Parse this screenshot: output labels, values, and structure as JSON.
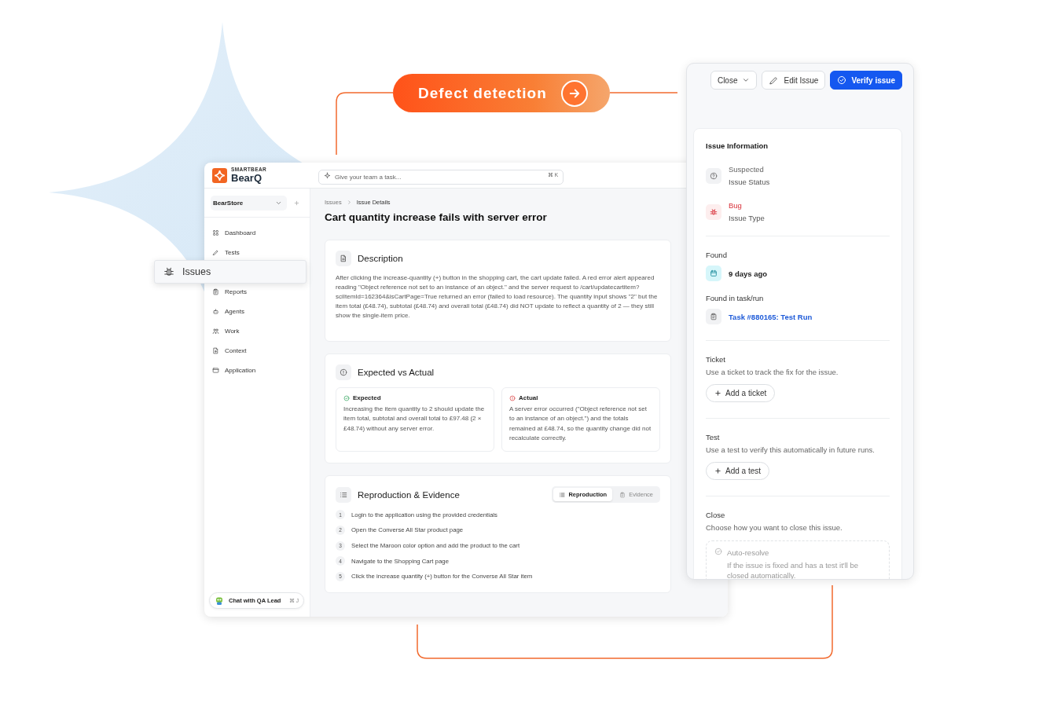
{
  "banner": {
    "label": "Defect detection"
  },
  "app": {
    "logo": {
      "brand": "SMARTBEAR",
      "product": "BearQ"
    },
    "search": {
      "placeholder": "Give your team a task...",
      "shortcut": "⌘ K"
    },
    "workspace": {
      "value": "BearStore"
    },
    "nav": [
      {
        "label": "Dashboard",
        "selected": false
      },
      {
        "label": "Tests",
        "selected": false
      },
      {
        "label": "Issues",
        "selected": true
      },
      {
        "label": "Reports",
        "selected": false
      },
      {
        "label": "Agents",
        "selected": false
      },
      {
        "label": "Work",
        "selected": false
      },
      {
        "label": "Context",
        "selected": false
      },
      {
        "label": "Application",
        "selected": false
      }
    ],
    "chat": {
      "label": "Chat with QA Lead",
      "shortcut": "⌘ J"
    },
    "breadcrumb": [
      "Issues",
      "Issue Details"
    ],
    "title": "Cart quantity increase fails with server error",
    "description": {
      "heading": "Description",
      "text": "After clicking the increase-quantity (+) button in the shopping cart, the cart update failed. A red error alert appeared reading \"Object reference not set to an instance of an object.\" and the server request to /cart/updatecartitem?sciItemId=162364&isCartPage=True returned an error (failed to load resource). The quantity input shows \"2\" but the item total (£48.74), subtotal (£48.74) and overall total (£48.74) did NOT update to reflect a quantity of 2 — they still show the single-item price."
    },
    "comparison": {
      "heading": "Expected vs Actual",
      "expected": {
        "label": "Expected",
        "text": "Increasing the item quantity to 2 should update the item total, subtotal and overall total to £97.48 (2 × £48.74) without any server error."
      },
      "actual": {
        "label": "Actual",
        "text": "A server error occurred (\"Object reference not set to an instance of an object.\") and the totals remained at £48.74, so the quantity change did not recalculate correctly."
      }
    },
    "reproduction": {
      "heading": "Reproduction & Evidence",
      "tabs": [
        {
          "label": "Reproduction",
          "selected": true
        },
        {
          "label": "Evidence",
          "selected": false
        }
      ],
      "steps": [
        {
          "number": "1",
          "text": "Login to the application using the provided credentials"
        },
        {
          "number": "2",
          "text": "Open the Converse All Star product page"
        },
        {
          "number": "3",
          "text": "Select the Maroon color option and add the product to the cart"
        },
        {
          "number": "4",
          "text": "Navigate to the Shopping Cart page"
        },
        {
          "number": "5",
          "text": "Click the increase quantity (+) button for the Converse All Star item"
        }
      ]
    }
  },
  "panel": {
    "actions": [
      {
        "label": "Close",
        "kind": "menu"
      },
      {
        "label": "Edit Issue",
        "kind": "edit"
      },
      {
        "label": "Verify issue",
        "kind": "primary"
      }
    ],
    "info": {
      "heading": "Issue Information",
      "fields": [
        {
          "value": "Suspected",
          "label": "Issue Status",
          "kind": "status"
        },
        {
          "value": "Bug",
          "label": "Issue Type",
          "kind": "bug"
        }
      ]
    },
    "found": {
      "label": "Found",
      "value": "9 days ago"
    },
    "task": {
      "label": "Found in task/run",
      "value": "Task #880165: Test Run"
    },
    "sections": [
      {
        "title": "Ticket",
        "text": "Use a ticket to track the fix for the issue.",
        "button": "Add a ticket"
      },
      {
        "title": "Test",
        "text": "Use a test to verify this automatically in future runs.",
        "button": "Add a test"
      }
    ],
    "close": {
      "title": "Close",
      "text": "Choose how you want to close this issue.",
      "option": {
        "label": "Auto-resolve",
        "text": "If the issue is fixed and has a test it'll be closed automatically.",
        "disabled": true
      }
    }
  }
}
